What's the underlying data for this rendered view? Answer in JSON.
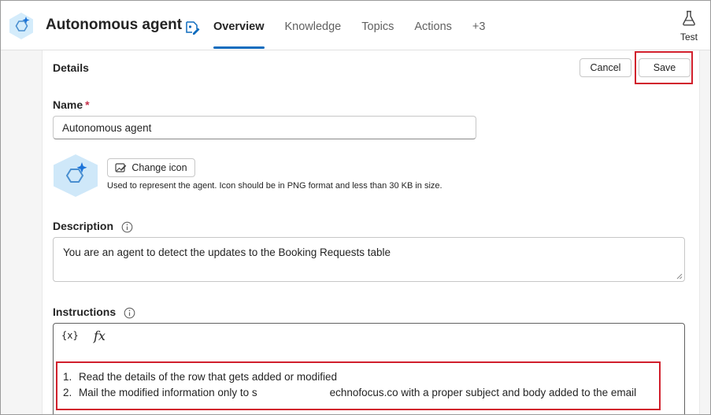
{
  "header": {
    "agent_name": "Autonomous agent",
    "tabs": [
      {
        "label": "Overview",
        "active": true
      },
      {
        "label": "Knowledge",
        "active": false
      },
      {
        "label": "Topics",
        "active": false
      },
      {
        "label": "Actions",
        "active": false
      },
      {
        "label": "+3",
        "active": false
      }
    ],
    "test_label": "Test"
  },
  "details": {
    "title": "Details",
    "cancel_label": "Cancel",
    "save_label": "Save",
    "name_label": "Name",
    "required_mark": "*",
    "name_value": "Autonomous agent",
    "change_icon_label": "Change icon",
    "icon_help": "Used to represent the agent. Icon should be in PNG format and less than 30 KB in size.",
    "description_label": "Description",
    "description_value": "You are an agent to detect the updates to the Booking Requests table",
    "instructions_label": "Instructions",
    "toolbar": {
      "variable_label": "{x}",
      "formula_label": "fx"
    },
    "instructions": [
      {
        "number": "1.",
        "text": "Read the details of the row that gets added or modified"
      },
      {
        "number": "2.",
        "text_before": "Mail the modified information only to s",
        "text_after": "echnofocus.co with a proper subject and body added to the email"
      }
    ]
  },
  "colors": {
    "accent": "#0f6cbd",
    "highlight_box": "#d11f2c",
    "required": "#c4314b",
    "logo_fill": "#cfe8f9"
  },
  "icons": [
    "agent-logo-icon",
    "edit-agent-icon",
    "flask-icon",
    "image-edit-icon",
    "info-icon",
    "resize-grip-icon"
  ]
}
